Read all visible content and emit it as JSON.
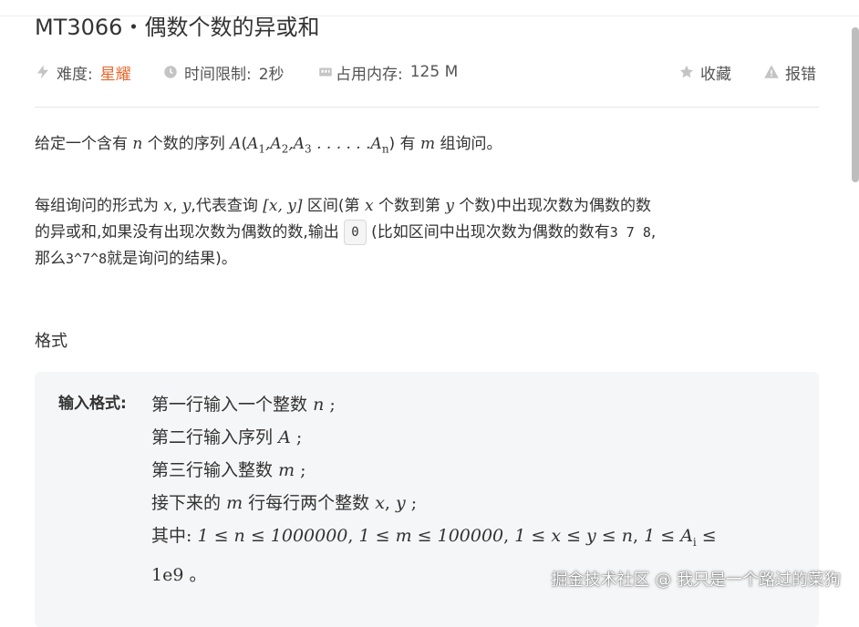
{
  "problem": {
    "title": "MT3066・偶数个数的异或和"
  },
  "meta": {
    "difficulty_label": "难度:",
    "difficulty_value": "星耀",
    "time_label": "时间限制:",
    "time_value": "2秒",
    "memory_label": "占用内存:",
    "memory_value": "125 M",
    "favorite_label": "收藏",
    "report_label": "报错",
    "icons": {
      "difficulty": "lightning-icon",
      "time": "clock-icon",
      "memory": "memory-chip-icon",
      "favorite": "star-icon",
      "report": "warning-icon"
    },
    "accent_color": "#e8672c"
  },
  "description": {
    "p1": {
      "t1": "给定一个含有",
      "n": "n",
      "t2": "个数的序列",
      "A": "A",
      "paren_open": "(",
      "seq": "A",
      "sub1": "1",
      "comma1": ",",
      "sub2": "2",
      "comma2": ",",
      "sub3": "3",
      "dots": " . . . . . .",
      "subn": "n",
      "paren_close": ")",
      "t3": "有",
      "m": "m",
      "t4": "组询问。"
    },
    "p2": {
      "l1_a": "每组询问的形式为",
      "x": "x",
      "sep": ",",
      "y": "y",
      "l1_b": ",代表查询",
      "range": "[x, y]",
      "l1_c": "区间(第",
      "x2": "x",
      "l1_d": "个数到第",
      "y2": "y",
      "l1_e": "个数)中出现次数为偶数的数",
      "l2_a": "的异或和,如果没有出现次数为偶数的数,输出",
      "zero_code": "0",
      "l2_b": "(比如区间中出现次数为偶数的数有",
      "example_nums": "3 7 8",
      "l2_c": ",",
      "l3_mono": "3^7^8",
      "l3_b": "就是询问的结果)。",
      "l3_a": "那么"
    }
  },
  "format": {
    "section_title": "格式",
    "input_label": "输入格式:",
    "line1_a": "第一行输入一个整数",
    "line1_n": "n",
    "line1_b": ";",
    "line2_a": "第二行输入序列",
    "line2_A": "A",
    "line2_b": ";",
    "line3_a": "第三行输入整数",
    "line3_m": "m",
    "line3_b": ";",
    "line4_a": "接下来的",
    "line4_m": "m",
    "line4_b": "行每行两个整数",
    "line4_x": "x",
    "line4_sep": ",",
    "line4_y": "y",
    "line4_c": ";",
    "line5_a": "其中:",
    "line5_c1": "1 ≤ n ≤ 1000000",
    "line5_s1": ",",
    "line5_c2": "1 ≤ m ≤ 100000",
    "line5_s2": ",",
    "line5_c3": "1 ≤ x ≤ y ≤ n",
    "line5_s3": ",",
    "line5_c4": "1 ≤ A",
    "line5_c4_sub": "i",
    "line5_c4_end": " ≤",
    "line6_a": "1e9",
    "line6_b": "。"
  },
  "watermark": "掘金技术社区 @ 我只是一个路过的菜狗"
}
